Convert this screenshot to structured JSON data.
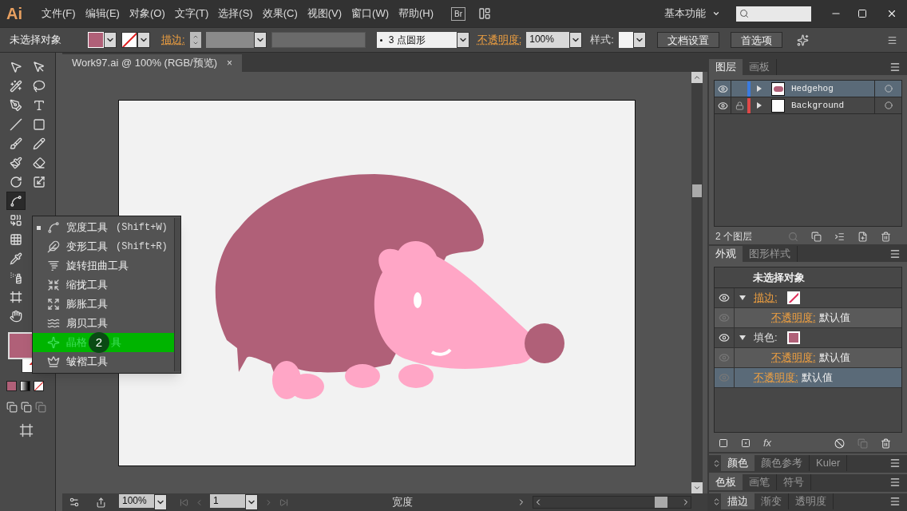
{
  "menu_bar": {
    "app_logo": "Ai",
    "menus": [
      "文件(F)",
      "编辑(E)",
      "对象(O)",
      "文字(T)",
      "选择(S)",
      "效果(C)",
      "视图(V)",
      "窗口(W)",
      "帮助(H)"
    ],
    "bridge_button": "Br",
    "workspace": "基本功能"
  },
  "control_bar": {
    "selection": "未选择对象",
    "stroke_label": "描边:",
    "brush": "3 点圆形",
    "opacity_label": "不透明度:",
    "opacity": "100%",
    "style_label": "样式:",
    "buttons": [
      "文档设置",
      "首选项"
    ]
  },
  "toolbox": {
    "rows": [
      [
        {
          "kind": "select",
          "selected": false
        },
        {
          "kind": "direct-select",
          "selected": false
        }
      ],
      [
        {
          "kind": "magic-wand",
          "selected": false
        },
        {
          "kind": "lasso",
          "selected": false
        }
      ],
      [
        {
          "kind": "pen",
          "selected": false
        },
        {
          "kind": "type",
          "selected": false
        }
      ],
      [
        {
          "kind": "line",
          "selected": false
        },
        {
          "kind": "rectangle",
          "selected": false
        }
      ],
      [
        {
          "kind": "paintbrush",
          "selected": false
        },
        {
          "kind": "pencil",
          "selected": false
        }
      ],
      [
        {
          "kind": "blob-brush",
          "selected": false
        },
        {
          "kind": "eraser",
          "selected": false
        }
      ],
      [
        {
          "kind": "rotate",
          "selected": false
        },
        {
          "kind": "scale",
          "selected": false
        }
      ],
      [
        {
          "kind": "width",
          "selected": true
        }
      ],
      [
        {
          "kind": "shape-builder",
          "selected": false
        }
      ],
      [
        {
          "kind": "mesh",
          "selected": false
        }
      ],
      [
        {
          "kind": "eyedropper",
          "selected": false
        }
      ],
      [
        {
          "kind": "symbol-spray",
          "selected": false
        }
      ],
      [
        {
          "kind": "artboard",
          "selected": false
        }
      ],
      [
        {
          "kind": "hand",
          "selected": false
        }
      ]
    ]
  },
  "document": {
    "tab": "Work97.ai @ 100% (RGB/预览)",
    "close": "×"
  },
  "tool_flyout": {
    "items": [
      {
        "kind": "width",
        "label": "宽度工具",
        "shortcut": "(Shift+W)",
        "current": true,
        "selected": false
      },
      {
        "kind": "warp",
        "label": "变形工具",
        "shortcut": "(Shift+R)",
        "current": false,
        "selected": false
      },
      {
        "kind": "twirl",
        "label": "旋转扭曲工具",
        "current": false,
        "selected": false
      },
      {
        "kind": "pucker",
        "label": "缩拢工具",
        "current": false,
        "selected": false
      },
      {
        "kind": "bloat",
        "label": "膨胀工具",
        "current": false,
        "selected": false
      },
      {
        "kind": "scallop",
        "label": "扇贝工具",
        "current": false,
        "selected": false
      },
      {
        "kind": "crystallize",
        "label": "晶格",
        "label_after_badge": "具",
        "current": false,
        "selected": true
      },
      {
        "kind": "wrinkle",
        "label": "皱褶工具",
        "current": false,
        "selected": false
      }
    ],
    "step_badge": "2"
  },
  "layers_panel": {
    "tabs": [
      {
        "label": "图层",
        "selected": true
      },
      {
        "label": "画板",
        "selected": false
      }
    ],
    "layers": [
      {
        "name": "Hedgehog",
        "kind": "artwork",
        "locked": false,
        "color": "#3a7be0",
        "selected": true
      },
      {
        "name": "Background",
        "kind": "blank",
        "locked": true,
        "color": "#e04848",
        "selected": false
      }
    ],
    "count": "2 个图层"
  },
  "appearance_panel": {
    "tabs": [
      {
        "label": "外观",
        "selected": true
      },
      {
        "label": "图形样式",
        "selected": false
      }
    ],
    "title": "未选择对象",
    "rows": [
      {
        "kind": "stroke",
        "label": "描边:",
        "selected": false,
        "children": [
          {
            "kind": "opacity",
            "label": "不透明度:",
            "value": "默认值",
            "selected": false
          }
        ]
      },
      {
        "kind": "fill",
        "label": "填色:",
        "selected": false,
        "children": [
          {
            "kind": "opacity",
            "label": "不透明度:",
            "value": "默认值",
            "selected": false
          }
        ]
      },
      {
        "kind": "opacity",
        "label": "不透明度:",
        "value": "默认值",
        "selected": true
      }
    ],
    "fx_button": "fx"
  },
  "collapsed_panels": [
    {
      "tabs": [
        {
          "label": "颜色",
          "selected": true
        },
        {
          "label": "颜色参考",
          "selected": false
        },
        {
          "label": "Kuler",
          "selected": false
        }
      ]
    },
    {
      "tabs": [
        {
          "label": "色板",
          "selected": true
        },
        {
          "label": "画笔",
          "selected": false
        },
        {
          "label": "符号",
          "selected": false
        }
      ]
    },
    {
      "tabs": [
        {
          "label": "描边",
          "selected": true
        },
        {
          "label": "渐变",
          "selected": false
        },
        {
          "label": "透明度",
          "selected": false
        }
      ]
    }
  ],
  "status_bar": {
    "zoom": "100%",
    "artboard": "1",
    "tool": "宽度"
  }
}
